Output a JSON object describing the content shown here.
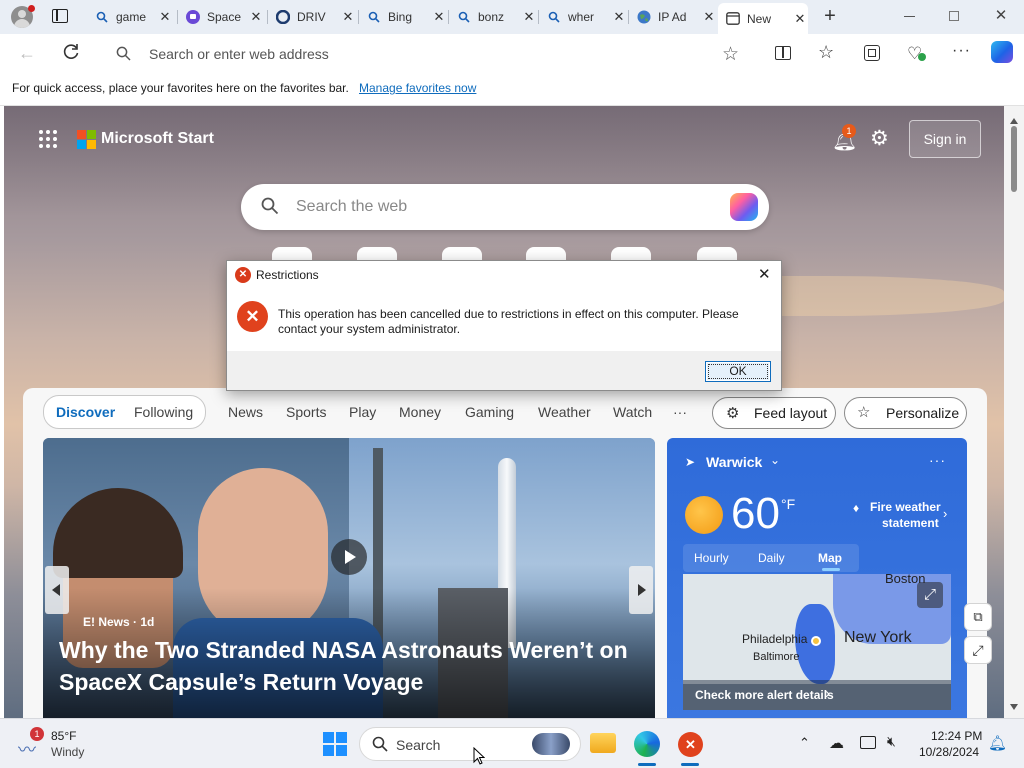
{
  "tabs": [
    {
      "label": "game",
      "icon": "search-icon"
    },
    {
      "label": "Space",
      "icon": "twitch-icon"
    },
    {
      "label": "DRIV",
      "icon": "drive-icon"
    },
    {
      "label": "Bing",
      "icon": "search-icon"
    },
    {
      "label": "bonz",
      "icon": "search-icon"
    },
    {
      "label": "wher",
      "icon": "search-icon"
    },
    {
      "label": "IP Ad",
      "icon": "globe-icon"
    },
    {
      "label": "New",
      "icon": "newtab-icon"
    }
  ],
  "address_bar": {
    "placeholder": "Search or enter web address"
  },
  "favorites_bar": {
    "text": "For quick access, place your favorites here on the favorites bar.",
    "link": "Manage favorites now"
  },
  "ms_start": {
    "brand": "Microsoft Start",
    "notification_count": "1",
    "sign_in": "Sign in",
    "search_placeholder": "Search the web"
  },
  "feed_nav": {
    "discover": "Discover",
    "following": "Following",
    "links": [
      "News",
      "Sports",
      "Play",
      "Money",
      "Gaming",
      "Weather",
      "Watch",
      "···"
    ],
    "feed_layout": "Feed layout",
    "personalize": "Personalize"
  },
  "hero": {
    "source": "E! News · 1d",
    "headline_line1": "Why the Two Stranded NASA Astronauts Weren’t on",
    "headline_line2": "SpaceX Capsule’s Return Voyage"
  },
  "weather": {
    "location": "Warwick",
    "temp": "60",
    "unit": "°F",
    "alert_line1": "Fire weather",
    "alert_line2": "statement",
    "tabs": [
      "Hourly",
      "Daily",
      "Map"
    ],
    "map_labels": [
      "Boston",
      "Philadelphia",
      "Baltimore",
      "New York"
    ],
    "alert_link": "Check more alert details"
  },
  "dialog": {
    "title": "Restrictions",
    "message_line1": "This operation has been cancelled due to restrictions in effect on this computer. Please",
    "message_line2": "contact your system administrator.",
    "ok": "OK"
  },
  "taskbar": {
    "weather_badge": "1",
    "weather_temp": "85°F",
    "weather_desc": "Windy",
    "search_label": "Search",
    "time": "12:24 PM",
    "date": "10/28/2024"
  },
  "colors": {
    "accent": "#0f6cbd",
    "error_red": "#d93b1b",
    "weather_blue": "#2f6bd9",
    "notification_orange": "#e65a1a"
  }
}
